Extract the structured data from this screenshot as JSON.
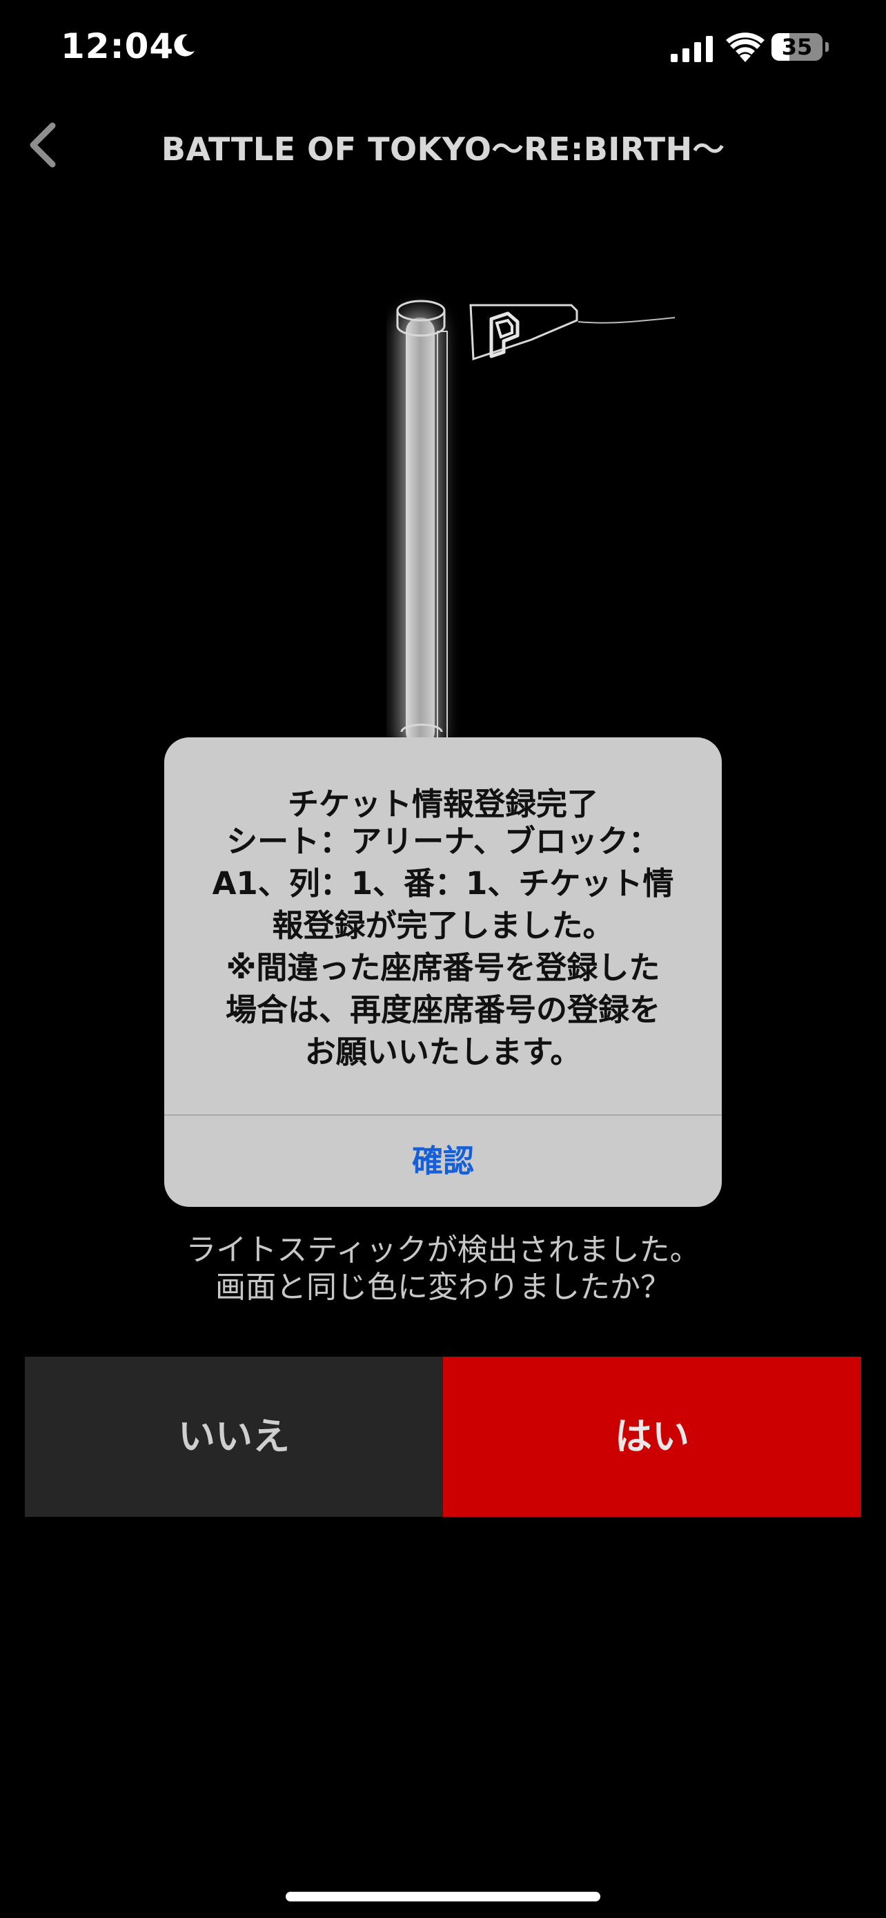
{
  "status_bar": {
    "time": "12:04",
    "battery_level": "35",
    "icons": [
      "moon-icon",
      "signal-icon",
      "wifi-icon",
      "battery-icon"
    ]
  },
  "nav": {
    "title": "BATTLE OF TOKYO〜RE:BIRTH〜",
    "back_icon": "chevron-left-icon"
  },
  "alert": {
    "title": "チケット情報登録完了",
    "message": "シート：アリーナ、ブロック：\nA1、列：1、番：1、チケット情\n報登録が完了しました。\n※間違った座席番号を登録した\n場合は、再度座席番号の登録を\nお願いいたします。",
    "confirm_label": "確認"
  },
  "question": "ライトスティックが検出されました。\n画面と同じ色に変わりましたか？",
  "buttons": {
    "no_label": "いいえ",
    "yes_label": "はい"
  },
  "colors": {
    "background": "#000000",
    "yes_button": "#cc0000",
    "no_button": "#262626",
    "alert_background": "#cbcbcb",
    "alert_action": "#1560d8"
  }
}
